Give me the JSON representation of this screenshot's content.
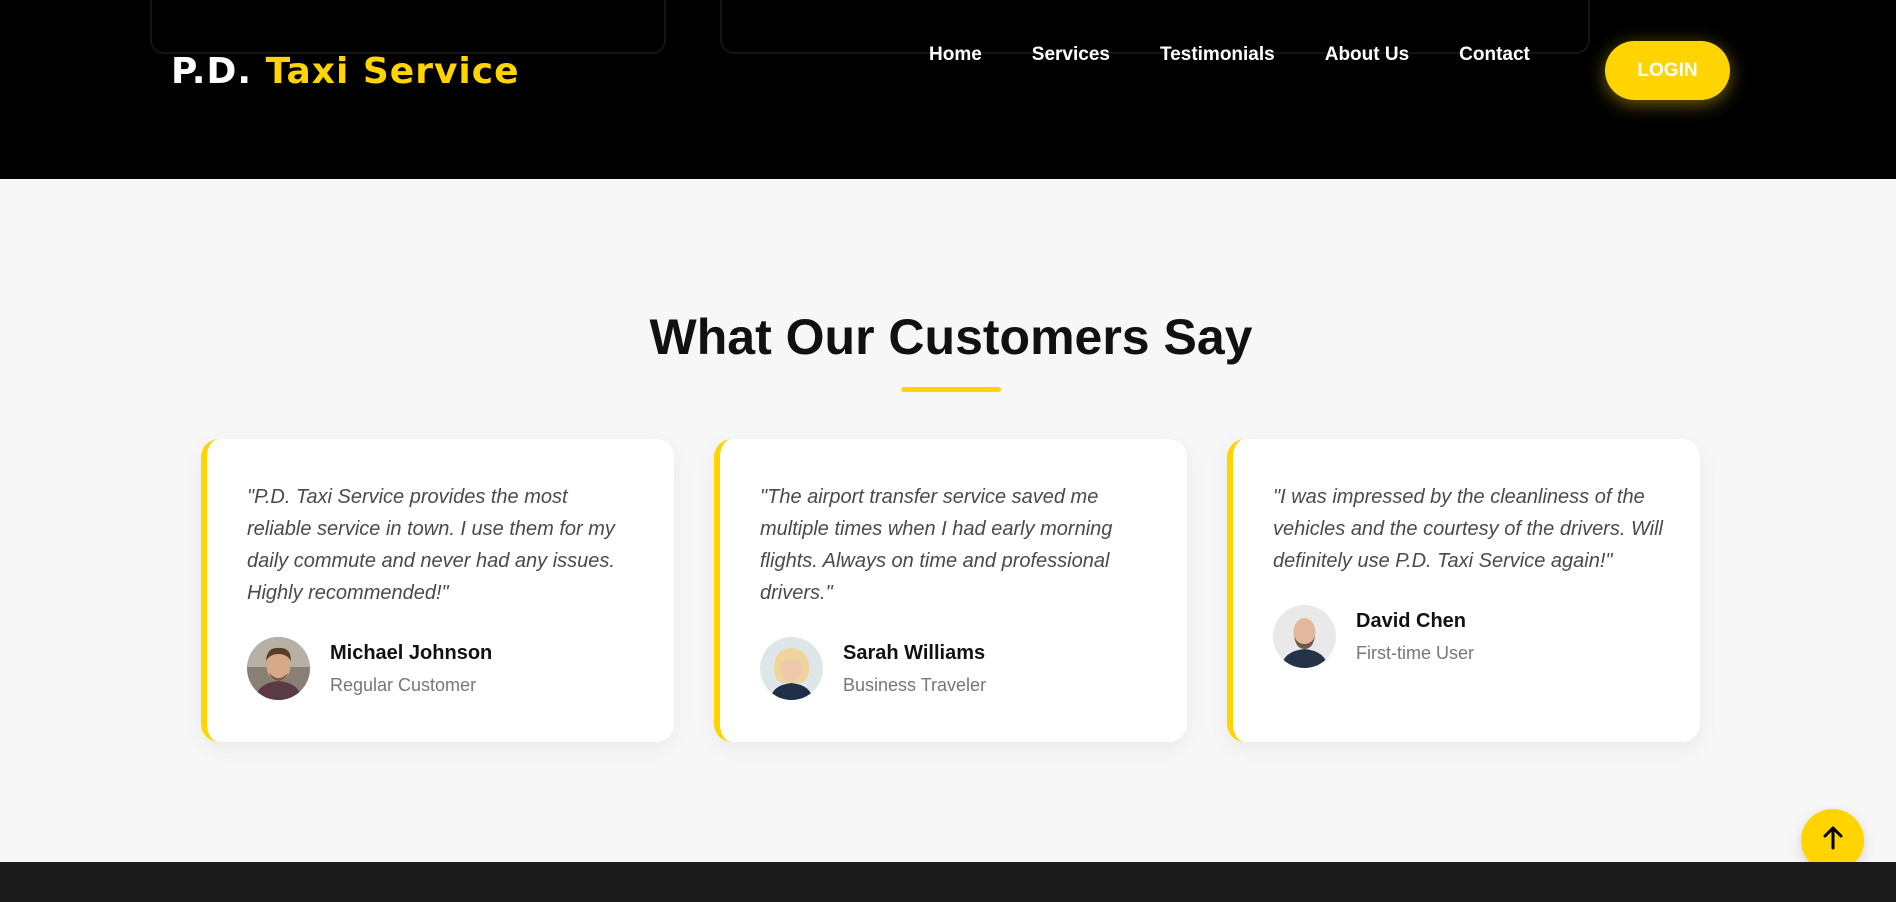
{
  "header": {
    "logo_part1": "P.D.",
    "logo_part2": "Taxi Service",
    "nav": [
      "Home",
      "Services",
      "Testimonials",
      "About Us",
      "Contact"
    ],
    "login_label": "LOGIN"
  },
  "testimonials": {
    "title": "What Our Customers Say",
    "items": [
      {
        "quote": "\"P.D. Taxi Service provides the most reliable service in town. I use them for my daily commute and never had any issues. Highly recommended!\"",
        "name": "Michael Johnson",
        "role": "Regular Customer"
      },
      {
        "quote": "\"The airport transfer service saved me multiple times when I had early morning flights. Always on time and professional drivers.\"",
        "name": "Sarah Williams",
        "role": "Business Traveler"
      },
      {
        "quote": "\"I was impressed by the cleanliness of the vehicles and the courtesy of the drivers. Will definitely use P.D. Taxi Service again!\"",
        "name": "David Chen",
        "role": "First-time User"
      }
    ]
  },
  "icons": {
    "scroll_top": "arrow-up-icon"
  },
  "colors": {
    "accent": "#ffd400",
    "header_bg": "#000000",
    "page_bg": "#f7f7f7",
    "footer_bg": "#1b1b1b"
  }
}
